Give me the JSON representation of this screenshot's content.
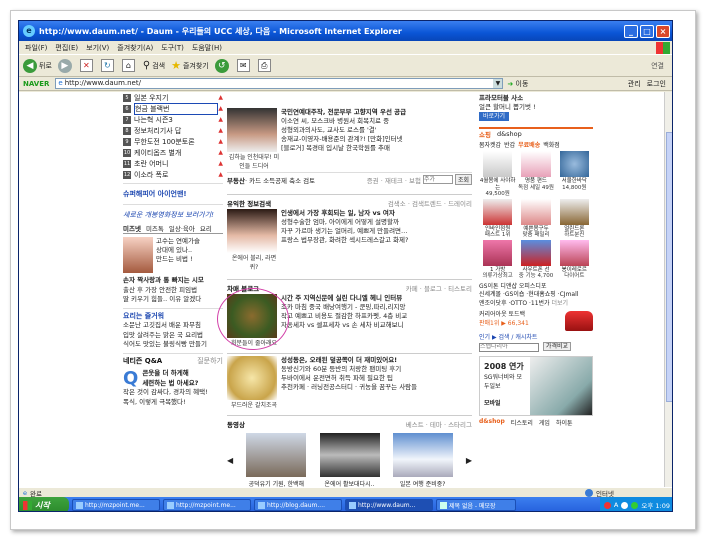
{
  "window": {
    "title": "http://www.daum.net/ - Daum - 우리들의 UCC 세상, 다음 - Microsoft Internet Explorer",
    "buttons": [
      "_",
      "□",
      "×"
    ]
  },
  "menu": [
    "파일(F)",
    "편집(E)",
    "보기(V)",
    "즐겨찾기(A)",
    "도구(T)",
    "도움말(H)"
  ],
  "toolbar": {
    "back": "뒤로",
    "search": "검색",
    "favorites": "즐겨찾기",
    "links": "연결"
  },
  "addressbar": {
    "naver": "NAVER",
    "url": "http://www.daum.net/",
    "move": "이동",
    "manage": "관리",
    "login": "로그인"
  },
  "left": {
    "ranks": [
      {
        "num": "5",
        "name": "일본 우지기",
        "arrow": "▲"
      },
      {
        "num": "6",
        "name": "현금 블랙번",
        "arrow": "▲"
      },
      {
        "num": "7",
        "name": "나는혁 시즌3",
        "arrow": "▲"
      },
      {
        "num": "8",
        "name": "정보처리기사 답",
        "arrow": "▲"
      },
      {
        "num": "9",
        "name": "무한도전 100분토론",
        "arrow": "▲"
      },
      {
        "num": "10",
        "name": "케이티옵즈 별개",
        "arrow": "▲"
      },
      {
        "num": "11",
        "name": "초란 어머니",
        "arrow": "▲"
      },
      {
        "num": "12",
        "name": "이소라 폭로",
        "arrow": "▲"
      }
    ],
    "daum_id": "슈퍼해피어 아이언맨!",
    "event": "새로운 개봉영화정보 보러가기!",
    "tabs": [
      "미즈넷",
      "미즈톡",
      "일상·육아",
      "요리"
    ],
    "photo_lines": [
      "고수는 연예가슬",
      "상대에 있나..",
      "만드는 비법 !"
    ],
    "story_lines": [
      "손자 짝사랑과 통 빠지는 시모",
      "출산 후 가장 안전한 피임법",
      "딸 키우기 힘들.. 이유 알겠다"
    ],
    "recipe_head": "요리는 즐거워",
    "recipe_lines": [
      "소문난 고깃집서 배운 파무침",
      "입맛 살려주는 맑은 국 요리법",
      "식어도 맛있는 불링식빵 만들기"
    ],
    "qna_head": "네티즌 Q&A",
    "qna_more": "질문하기",
    "qna_q": [
      "콘웃을 더 하게해",
      "세련하는 법 아세요?"
    ],
    "qna_lines": [
      "작은 것이 감싸다, 경차의 혜택!",
      "폭식, 이렇게 극복했다!"
    ]
  },
  "mid": {
    "news_lines": [
      "국민연예대주작, 전문부부 고향지역 우선 공급",
      "이소연 씨, 모스크바 병원서 회복치료 중",
      "성형외과의사도, 교사도 로스를 '결'",
      "송재교-이영자-배용준의 관계?! [만화]인터넷",
      "[블로거] 복경태 입시날 한국학원를 추매"
    ],
    "news_caption": "김하늘 인천대부! 미인들 드디어",
    "realty": {
      "label": "부동산",
      "text": "· 카드 소득공제 축소 검토",
      "sub": "증권 · 재테크 · 보험",
      "input": "주가",
      "btn": "조회"
    },
    "beauty": {
      "head": "유익한 정보검색",
      "sub": "검색소 · 검색트렌드 · 드레이리",
      "caption": "온에어 블리, 라면 퀴?",
      "lines": [
        "인생에서 가장 후회되는 일, 남자 vs 여자",
        "성형수술한 엄마, 아이에게 어떻게 설명할까",
        "자꾸 가르마 생기는 얼머리, 예쁘게 만들려면…",
        "프랑스 법무장관, 화려한 섹시드레스갈고 화제?"
      ]
    },
    "blog": {
      "head": "차매 블로그",
      "sub": "카페 · 블로그 · 티스토리",
      "caption": "회분들이 줄아래요",
      "lines": [
        "시간 주 지역신문에 실린 다니엘 헤니 인터뷰",
        "조카 마침 중국 배낭여행기 - 쿤밍,따리,리지앙",
        "작고 예쁘고 비용도 절감한 하프카펫, 4층 비교",
        "자동세차 vs 셀프세차 vs 손 세차 비교해보니"
      ]
    },
    "news2": {
      "caption": "부드러운 갈치조곡",
      "lines": [
        "성성동은, 오래된 덮공쪽이 더 재미있어요!",
        "동방신기와 60분 등반의 처랑한 팬미팅 후기",
        "두바이에서 운전면허 취득 파헤 필요한 팁",
        "추천카페 · 러닝전공스터디 · 귀농을 꿈꾸는 사람들"
      ]
    },
    "video": {
      "head": "동영상",
      "sub": "베스트 · 테마 · 스타리그",
      "items": [
        "공덕유기 기원, 한백해",
        "온에어 활보대다시..",
        "일본 여행 준비중?"
      ]
    }
  },
  "right": {
    "ad_lines": [
      "프라모터블 사소",
      "얼큰 할머니 뽑기벗 !"
    ],
    "ad_btn": "바로가기",
    "shop": {
      "head": "쇼핑",
      "mall": "d&shop",
      "tabs": [
        "봄자켓감",
        "반갑",
        "무료배송",
        "백화점"
      ],
      "items": [
        {
          "name": "4월봄에 사야하는",
          "price": "49,500원"
        },
        {
          "name": "명품 편드",
          "price": "독점 세일 49원"
        },
        {
          "name": "서울한바닥",
          "price": "14,800원"
        },
        {
          "name": "인바인점원",
          "price": "패스트 1위"
        },
        {
          "name": "예쁜봄구두",
          "price": "맞춤 패밀리"
        },
        {
          "name": "얼린드론",
          "price": "하트분진"
        },
        {
          "name": "1 가방",
          "price": "의류가상최고"
        },
        {
          "name": "사우트폰 선",
          "price": "중 기능 4,700"
        },
        {
          "name": "봉이레로르",
          "price": "다이어트"
        }
      ]
    },
    "gs": [
      "GS이톤 디앤샵 오피스디포",
      "신세계몰 ·GS이숍 ·현대홈쇼핑 ·CJmall",
      "엔조이닷후 ·OTTO ·11번가"
    ],
    "gs_more": "더보기",
    "cash": [
      "커리어아웃 토드백",
      "판매1위 ▶ 66,341"
    ],
    "cash_label": "인기 ▶ 검색 / 캐시차트",
    "cash_input": "스텝다리아",
    "cash_btn": "가격비교",
    "yeonga": {
      "year": "2008 연가",
      "sub": "SG워너비와 모두일보",
      "mall": "모바일"
    },
    "footer": [
      "d&shop",
      "티스토리",
      "게임",
      "하이툰"
    ]
  },
  "status": {
    "left": "완료",
    "zone": "인터넷"
  },
  "taskbar": {
    "start": "시작",
    "tasks": [
      "http://mzpoint.me...",
      "http://mzpoint.me...",
      "http://blog.daum....",
      "http://www.daum...",
      "제목 없음 - 메모장"
    ],
    "time": "오후 1:09"
  }
}
